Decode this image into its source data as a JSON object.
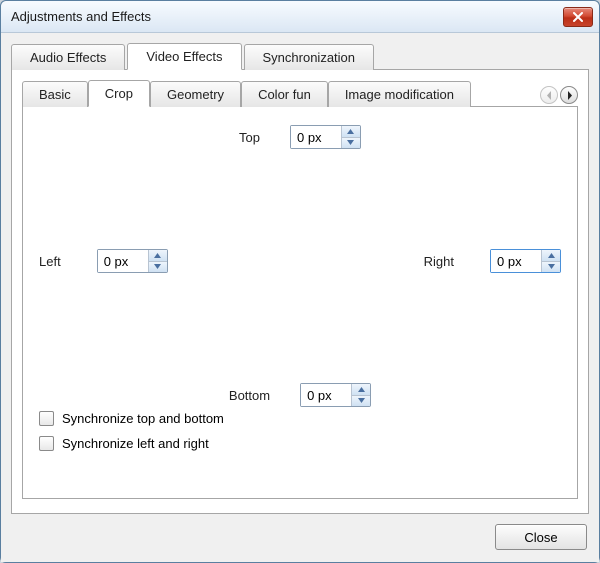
{
  "window": {
    "title": "Adjustments and Effects"
  },
  "tabs": {
    "audio": "Audio Effects",
    "video": "Video Effects",
    "sync": "Synchronization"
  },
  "subtabs": {
    "basic": "Basic",
    "crop": "Crop",
    "geometry": "Geometry",
    "colorfun": "Color fun",
    "imagemod": "Image modification"
  },
  "crop": {
    "top_label": "Top",
    "bottom_label": "Bottom",
    "left_label": "Left",
    "right_label": "Right",
    "top_value": "0 px",
    "bottom_value": "0 px",
    "left_value": "0 px",
    "right_value": "0 px",
    "sync_tb": "Synchronize top and bottom",
    "sync_lr": "Synchronize left and right",
    "sync_tb_checked": false,
    "sync_lr_checked": false
  },
  "footer": {
    "close": "Close"
  }
}
